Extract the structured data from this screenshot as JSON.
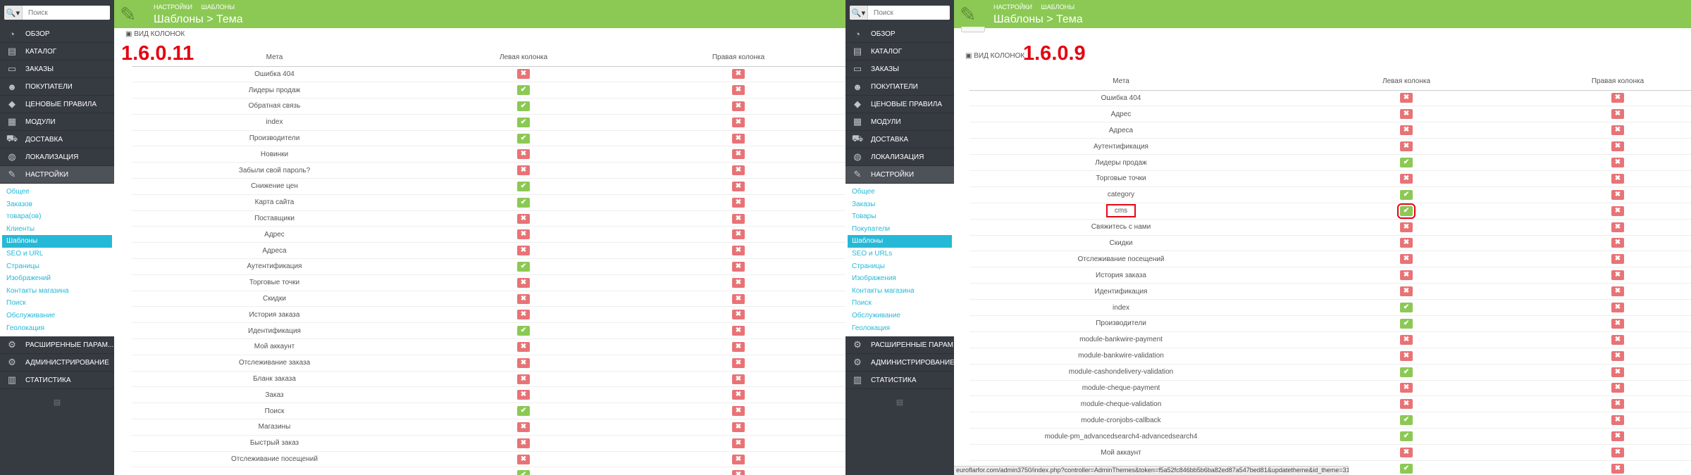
{
  "left": {
    "search": {
      "btn": "🔍▾",
      "placeholder": "Поиск"
    },
    "menu": [
      {
        "icon": "dashboard-icon",
        "glyph": "◔",
        "label": "Обзор"
      },
      {
        "icon": "catalog-icon",
        "glyph": "▤",
        "label": "Каталог"
      },
      {
        "icon": "orders-icon",
        "glyph": "▭",
        "label": "Заказы"
      },
      {
        "icon": "customers-icon",
        "glyph": "☻",
        "label": "Покупатели"
      },
      {
        "icon": "price-rules-icon",
        "glyph": "◆",
        "label": "Ценовые правила"
      },
      {
        "icon": "modules-icon",
        "glyph": "▦",
        "label": "Модули"
      },
      {
        "icon": "shipping-icon",
        "glyph": "⛟",
        "label": "Доставка"
      },
      {
        "icon": "localization-icon",
        "glyph": "◍",
        "label": "Локализация"
      },
      {
        "icon": "wrench-icon",
        "glyph": "✎",
        "label": "Настройки",
        "active": true
      }
    ],
    "submenu": [
      {
        "label": "Общее"
      },
      {
        "label": "Заказов"
      },
      {
        "label": "товара(ов)"
      },
      {
        "label": "Клиенты"
      },
      {
        "label": "Шаблоны",
        "active": true
      },
      {
        "label": "SEO и URL"
      },
      {
        "label": "Страницы"
      },
      {
        "label": "Изображений"
      },
      {
        "label": "Контакты магазина"
      },
      {
        "label": "Поиск"
      },
      {
        "label": "Обслуживание"
      },
      {
        "label": "Геолокация"
      }
    ],
    "menu2": [
      {
        "icon": "advanced-params-icon",
        "glyph": "⚙",
        "label": "Расширенные парам..."
      },
      {
        "icon": "admin-icon",
        "glyph": "⚙",
        "label": "Администрирование"
      },
      {
        "icon": "stats-icon",
        "glyph": "▥",
        "label": "Статистика"
      }
    ],
    "footer": "▤",
    "breadcrumb": [
      "Настройки",
      "Шаблоны"
    ],
    "title": "Шаблоны > Тема",
    "section": "Вид колонок",
    "version": "1.6.0.11",
    "columns": [
      "Мета",
      "Левая колонка",
      "Правая колонка"
    ],
    "rows": [
      {
        "m": "Ошибка 404",
        "l": false,
        "r": false
      },
      {
        "m": "Лидеры продаж",
        "l": true,
        "r": false
      },
      {
        "m": "Обратная связь",
        "l": true,
        "r": false
      },
      {
        "m": "index",
        "l": true,
        "r": false
      },
      {
        "m": "Производители",
        "l": true,
        "r": false
      },
      {
        "m": "Новинки",
        "l": false,
        "r": false
      },
      {
        "m": "Забыли свой пароль?",
        "l": false,
        "r": false
      },
      {
        "m": "Снижение цен",
        "l": true,
        "r": false
      },
      {
        "m": "Карта сайта",
        "l": true,
        "r": false
      },
      {
        "m": "Поставщики",
        "l": false,
        "r": false
      },
      {
        "m": "Адрес",
        "l": false,
        "r": false
      },
      {
        "m": "Адреса",
        "l": false,
        "r": false
      },
      {
        "m": "Аутентификация",
        "l": true,
        "r": false
      },
      {
        "m": "Торговые точки",
        "l": false,
        "r": false
      },
      {
        "m": "Скидки",
        "l": false,
        "r": false
      },
      {
        "m": "История заказа",
        "l": false,
        "r": false
      },
      {
        "m": "Идентификация",
        "l": true,
        "r": false
      },
      {
        "m": "Мой аккаунт",
        "l": false,
        "r": false
      },
      {
        "m": "Отслеживание заказа",
        "l": false,
        "r": false
      },
      {
        "m": "Бланк заказа",
        "l": false,
        "r": false
      },
      {
        "m": "Заказ",
        "l": false,
        "r": false
      },
      {
        "m": "Поиск",
        "l": true,
        "r": false
      },
      {
        "m": "Магазины",
        "l": false,
        "r": false
      },
      {
        "m": "Быстрый заказ",
        "l": false,
        "r": false
      },
      {
        "m": "Отслеживание посещений",
        "l": false,
        "r": false
      },
      {
        "m": "",
        "l": true,
        "r": false
      }
    ]
  },
  "right": {
    "search": {
      "btn": "🔍▾",
      "placeholder": "Поиск"
    },
    "menu": [
      {
        "icon": "dashboard-icon",
        "glyph": "◔",
        "label": "Обзор"
      },
      {
        "icon": "catalog-icon",
        "glyph": "▤",
        "label": "Каталог"
      },
      {
        "icon": "orders-icon",
        "glyph": "▭",
        "label": "Заказы"
      },
      {
        "icon": "customers-icon",
        "glyph": "☻",
        "label": "Покупатели"
      },
      {
        "icon": "price-rules-icon",
        "glyph": "◆",
        "label": "Ценовые правила"
      },
      {
        "icon": "modules-icon",
        "glyph": "▦",
        "label": "Модули"
      },
      {
        "icon": "shipping-icon",
        "glyph": "⛟",
        "label": "Доставка"
      },
      {
        "icon": "localization-icon",
        "glyph": "◍",
        "label": "Локализация"
      },
      {
        "icon": "wrench-icon",
        "glyph": "✎",
        "label": "Настройки",
        "active": true
      }
    ],
    "submenu": [
      {
        "label": "Общее"
      },
      {
        "label": "Заказы"
      },
      {
        "label": "Товары"
      },
      {
        "label": "Покупатели"
      },
      {
        "label": "Шаблоны",
        "active": true
      },
      {
        "label": "SEO и URLs"
      },
      {
        "label": "Страницы"
      },
      {
        "label": "Изображения"
      },
      {
        "label": "Контакты магазина"
      },
      {
        "label": "Поиск"
      },
      {
        "label": "Обслуживание"
      },
      {
        "label": "Геолокация"
      }
    ],
    "menu2": [
      {
        "icon": "advanced-params-icon",
        "glyph": "⚙",
        "label": "Расширенные парам..."
      },
      {
        "icon": "admin-icon",
        "glyph": "⚙",
        "label": "Администрирование"
      },
      {
        "icon": "stats-icon",
        "glyph": "▥",
        "label": "Статистика"
      }
    ],
    "footer": "▤",
    "breadcrumb": [
      "Настройки",
      "Шаблоны"
    ],
    "title": "Шаблоны > Тема",
    "section": "Вид колонок",
    "version": "1.6.0.9",
    "columns": [
      "Мета",
      "Левая колонка",
      "Правая колонка"
    ],
    "rows": [
      {
        "m": "Ошибка 404",
        "l": false,
        "r": false
      },
      {
        "m": "Адрес",
        "l": false,
        "r": false
      },
      {
        "m": "Адреса",
        "l": false,
        "r": false
      },
      {
        "m": "Аутентификация",
        "l": false,
        "r": false
      },
      {
        "m": "Лидеры продаж",
        "l": true,
        "r": false
      },
      {
        "m": "Торговые точки",
        "l": false,
        "r": false
      },
      {
        "m": "category",
        "l": true,
        "r": false
      },
      {
        "m": "cms",
        "l": true,
        "r": false,
        "hl": true
      },
      {
        "m": "Свяжитесь с нами",
        "l": false,
        "r": false
      },
      {
        "m": "Скидки",
        "l": false,
        "r": false
      },
      {
        "m": "Отслеживание посещений",
        "l": false,
        "r": false
      },
      {
        "m": "История заказа",
        "l": false,
        "r": false
      },
      {
        "m": "Идентификация",
        "l": false,
        "r": false
      },
      {
        "m": "index",
        "l": true,
        "r": false
      },
      {
        "m": "Производители",
        "l": true,
        "r": false
      },
      {
        "m": "module-bankwire-payment",
        "l": false,
        "r": false
      },
      {
        "m": "module-bankwire-validation",
        "l": false,
        "r": false
      },
      {
        "m": "module-cashondelivery-validation",
        "l": true,
        "r": false
      },
      {
        "m": "module-cheque-payment",
        "l": false,
        "r": false
      },
      {
        "m": "module-cheque-validation",
        "l": false,
        "r": false
      },
      {
        "m": "module-cronjobs-callback",
        "l": true,
        "r": false
      },
      {
        "m": "module-pm_advancedsearch4-advancedsearch4",
        "l": true,
        "r": false
      },
      {
        "m": "Мой аккаунт",
        "l": false,
        "r": false
      },
      {
        "m": "",
        "l": true,
        "r": false
      }
    ],
    "status": "euroflarfor.com/admin3750/index.php?controller=AdminThemes&token=f5a52fc846bb5b6ba82ed87a547bed81&updatetheme&id_theme=31"
  }
}
